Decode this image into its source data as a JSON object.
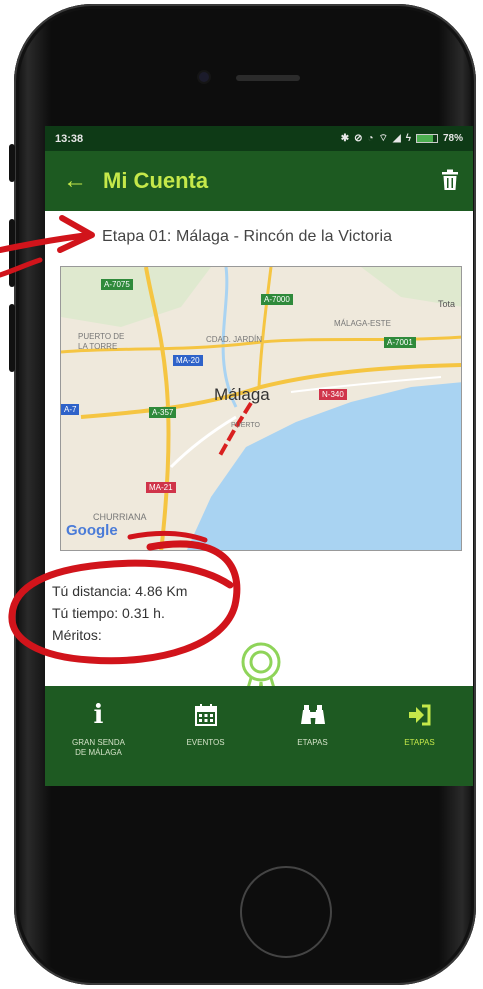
{
  "status_bar": {
    "time": "13:38",
    "battery": "78%",
    "icons": [
      "bluetooth-icon",
      "alarm-icon",
      "dnd-icon",
      "wifi-icon",
      "signal-icon",
      "charging-icon",
      "battery-icon"
    ]
  },
  "app_bar": {
    "title": "Mi Cuenta",
    "back_icon": "arrow-left-icon",
    "action_icon": "trash-icon"
  },
  "stage": {
    "title": "Etapa 01: Málaga - Rincón de la Victoria"
  },
  "map": {
    "city": "Málaga",
    "labels": {
      "puerto": "PUERTO DE",
      "torre": "LA TORRE",
      "ciudad_jardin": "CDAD. JARDÍN",
      "malaga_este": "MÁLAGA-ESTE",
      "churriana": "CHURRIANA",
      "puerto_city": "PUERTO",
      "tota": "Tota"
    },
    "road_shields": {
      "a7075": "A-7075",
      "a7000": "A-7000",
      "a7001": "A-7001",
      "ma20": "MA-20",
      "a7": "A-7",
      "a357": "A-357",
      "n340": "N-340",
      "ma21": "MA-21"
    },
    "provider": "Google",
    "colors": {
      "land": "#efe9dc",
      "water": "#a9d3f2",
      "route": "#d92020",
      "highway": "#f5c542"
    }
  },
  "stats": {
    "distance": "Tú distancia: 4.86 Km",
    "time": "Tú tiempo: 0.31 h.",
    "merits": "Méritos:"
  },
  "merit_icon": "award-ribbon-icon",
  "bottom_nav": {
    "items": [
      {
        "label": "GRAN SENDA\nDE MÁLAGA",
        "icon": "info-icon"
      },
      {
        "label": "EVENTOS",
        "icon": "calendar-icon"
      },
      {
        "label": "ETAPAS",
        "icon": "binoculars-icon"
      },
      {
        "label": "ETAPAS",
        "icon": "sign-in-icon"
      }
    ]
  },
  "colors": {
    "primary": "#1d5a21",
    "status_bar": "#0e3a16",
    "accent": "#c5e84a",
    "annotation": "#d1141b"
  }
}
